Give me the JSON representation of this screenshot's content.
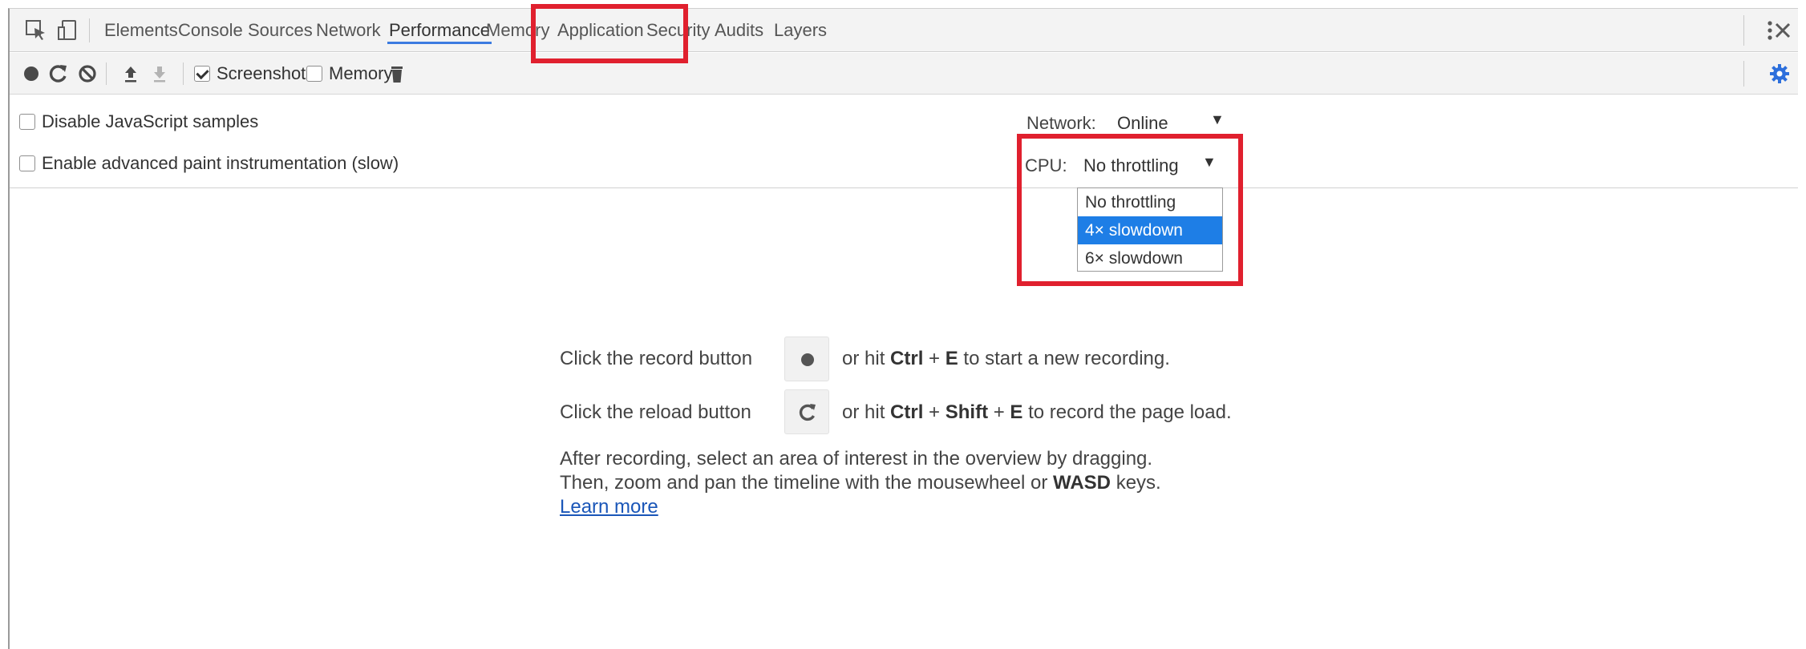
{
  "tabs": {
    "elements": "Elements",
    "console": "Console",
    "sources": "Sources",
    "network": "Network",
    "performance": "Performance",
    "memory": "Memory",
    "application": "Application",
    "security": "Security",
    "audits": "Audits",
    "layers": "Layers",
    "active": "Performance"
  },
  "toolbar": {
    "screenshots_label": "Screenshots",
    "screenshots_checked": true,
    "memory_label": "Memory",
    "memory_checked": false
  },
  "settings": {
    "disable_js_samples": "Disable JavaScript samples",
    "advanced_paint": "Enable advanced paint instrumentation (slow)",
    "network_label": "Network:",
    "network_value": "Online",
    "cpu_label": "CPU:",
    "cpu_value": "No throttling",
    "cpu_options": [
      "No throttling",
      "4× slowdown",
      "6× slowdown"
    ],
    "cpu_highlighted": "4× slowdown"
  },
  "landing": {
    "record_pre": "Click the record button",
    "record_post_a": "or hit",
    "record_key1": "Ctrl",
    "plus": "+",
    "record_key2": "E",
    "record_post_b": "to start a new recording.",
    "reload_pre": "Click the reload button",
    "reload_post_a": "or hit",
    "reload_key1": "Ctrl",
    "reload_key2": "Shift",
    "reload_key3": "E",
    "reload_post_b": "to record the page load.",
    "hint_line1": "After recording, select an area of interest in the overview by dragging.",
    "hint_line2_a": "Then, zoom and pan the timeline with the mousewheel or",
    "hint_line2_key": "WASD",
    "hint_line2_b": "keys.",
    "learn_more": "Learn more"
  },
  "colors": {
    "accent": "#3b7be0",
    "highlight_red": "#e0202e",
    "selection_blue": "#1e7ee6",
    "settings_gear": "#2d6fdc"
  }
}
